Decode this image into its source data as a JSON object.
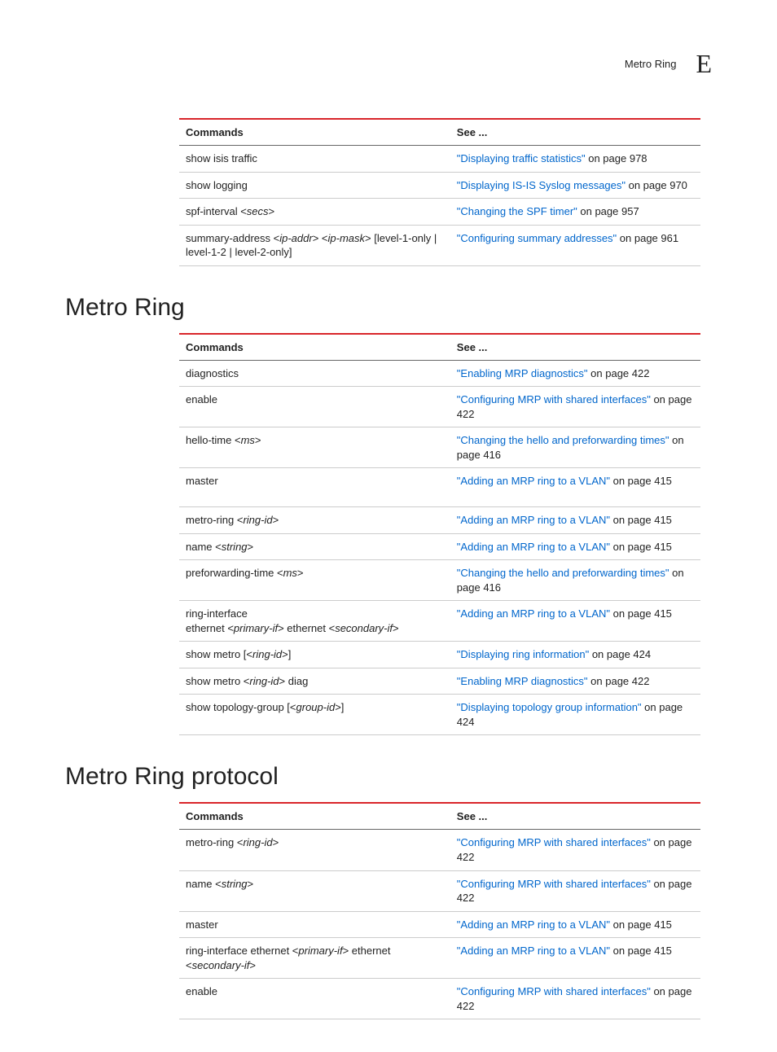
{
  "header": {
    "running_title": "Metro Ring",
    "appendix_letter": "E"
  },
  "columns": {
    "commands": "Commands",
    "see": "See ..."
  },
  "top_table": {
    "rows": [
      {
        "cmd_plain": "show isis traffic",
        "link": "\"Displaying traffic statistics\"",
        "page": " on page 978"
      },
      {
        "cmd_plain": "show logging",
        "link": "\"Displaying IS-IS Syslog messages\"",
        "page": " on page 970"
      },
      {
        "cmd_prefix": "spf-interval <",
        "cmd_ital": "secs",
        "cmd_suffix": ">",
        "link": "\"Changing the SPF timer\"",
        "page": " on page 957"
      },
      {
        "cmd_prefix": "summary-address <",
        "cmd_ital": "ip-addr",
        "cmd_mid1": "> <",
        "cmd_ital2": "ip-mask",
        "cmd_suffix": "> [level-1-only | level-1-2 | level-2-only]",
        "link": "\"Configuring summary addresses\"",
        "page": " on page 961"
      }
    ]
  },
  "sections": [
    {
      "title": "Metro Ring",
      "rows": [
        {
          "cmd_plain": "diagnostics",
          "link": "\"Enabling MRP diagnostics\"",
          "page": " on page 422"
        },
        {
          "cmd_plain": "enable",
          "link": "\"Configuring MRP with shared interfaces\"",
          "page": " on page 422"
        },
        {
          "cmd_prefix": "hello-time <",
          "cmd_ital": "ms",
          "cmd_suffix": ">",
          "link": "\"Changing the hello and preforwarding times\"",
          "page": " on page 416"
        },
        {
          "cmd_plain": "master",
          "link": "\"Adding an MRP ring to a VLAN\"",
          "page": " on page 415",
          "extra_pad": true
        },
        {
          "cmd_prefix": "metro-ring <",
          "cmd_ital": "ring-id",
          "cmd_suffix": ">",
          "link": "\"Adding an MRP ring to a VLAN\"",
          "page": " on page 415"
        },
        {
          "cmd_prefix": "name <",
          "cmd_ital": "string",
          "cmd_suffix": ">",
          "link": "\"Adding an MRP ring to a VLAN\"",
          "page": " on page 415"
        },
        {
          "cmd_prefix": "preforwarding-time <",
          "cmd_ital": "ms",
          "cmd_suffix": ">",
          "link": "\"Changing the hello and preforwarding times\"",
          "page": " on page 416"
        },
        {
          "cmd_prefix": "ring-interface\nethernet <",
          "cmd_ital": "primary-if",
          "cmd_mid1": "> ethernet <",
          "cmd_ital2": "secondary-if",
          "cmd_suffix": ">",
          "link": "\"Adding an MRP ring to a VLAN\"",
          "page": " on page 415"
        },
        {
          "cmd_prefix": "show metro [<",
          "cmd_ital": "ring-id",
          "cmd_suffix": ">]",
          "link": "\"Displaying ring information\"",
          "page": " on page 424"
        },
        {
          "cmd_prefix": "show metro <",
          "cmd_ital": "ring-id",
          "cmd_suffix": "> diag",
          "link": "\"Enabling MRP diagnostics\"",
          "page": " on page 422"
        },
        {
          "cmd_prefix": "show topology-group [<",
          "cmd_ital": "group-id",
          "cmd_suffix": ">]",
          "link": "\"Displaying topology group information\"",
          "page": " on page 424"
        }
      ]
    },
    {
      "title": "Metro Ring protocol",
      "rows": [
        {
          "cmd_prefix": "metro-ring <",
          "cmd_ital": "ring-id",
          "cmd_suffix": ">",
          "link": "\"Configuring MRP with shared interfaces\"",
          "page": " on page 422"
        },
        {
          "cmd_prefix": "name <",
          "cmd_ital": "string",
          "cmd_suffix": ">",
          "link": "\"Configuring MRP with shared interfaces\"",
          "page": " on page 422"
        },
        {
          "cmd_plain": "master",
          "link": "\"Adding an MRP ring to a VLAN\"",
          "page": " on page 415"
        },
        {
          "cmd_prefix": "ring-interface ethernet <",
          "cmd_ital": "primary-if",
          "cmd_mid1": "> ethernet <",
          "cmd_ital2": "secondary-if",
          "cmd_suffix": ">",
          "link": "\"Adding an MRP ring to a VLAN\"",
          "page": " on page 415"
        },
        {
          "cmd_plain": "enable",
          "link": "\"Configuring MRP with shared interfaces\"",
          "page": " on page 422"
        }
      ]
    }
  ]
}
